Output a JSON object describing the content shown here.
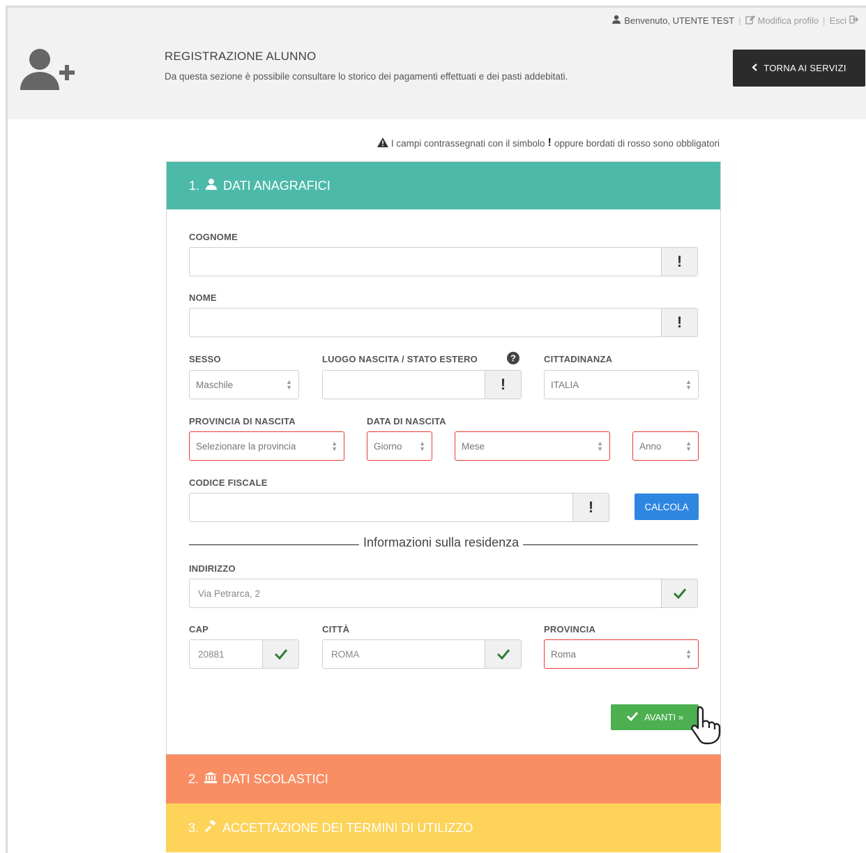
{
  "topbar": {
    "welcome": "Benvenuto, UTENTE TEST",
    "edit_profile": "Modifica profilo",
    "logout": "Esci",
    "separator": "|"
  },
  "header": {
    "title": "REGISTRAZIONE ALUNNO",
    "description": "Da questa sezione è possibile consultare lo storico dei pagamenti effettuati e dei pasti addebitati.",
    "back_button": "TORNA AI SERVIZI"
  },
  "required_note": {
    "before": "I campi contrassegnati con il simbolo",
    "after": "oppure bordati di rosso sono obbligatori"
  },
  "step1": {
    "number": "1.",
    "title": "DATI ANAGRAFICI",
    "color": "#4dbaa9"
  },
  "form": {
    "cognome": {
      "label": "COGNOME",
      "value": ""
    },
    "nome": {
      "label": "NOME",
      "value": ""
    },
    "sesso": {
      "label": "SESSO",
      "value": "Maschile"
    },
    "luogo_nascita": {
      "label": "LUOGO NASCITA / STATO ESTERO",
      "value": ""
    },
    "cittadinanza": {
      "label": "CITTADINANZA",
      "value": "ITALIA"
    },
    "provincia_nascita": {
      "label": "PROVINCIA DI NASCITA",
      "value": "Selezionare la provincia"
    },
    "data_nascita": {
      "label": "DATA DI NASCITA",
      "giorno": "Giorno",
      "mese": "Mese",
      "anno": "Anno"
    },
    "codice_fiscale": {
      "label": "CODICE FISCALE",
      "value": ""
    },
    "calcola_button": "CALCOLA",
    "residenza_divider": "Informazioni sulla residenza",
    "indirizzo": {
      "label": "INDIRIZZO",
      "value": "Via Petrarca, 2"
    },
    "cap": {
      "label": "CAP",
      "value": "20881"
    },
    "citta": {
      "label": "CITTÀ",
      "value": "ROMA"
    },
    "provincia": {
      "label": "PROVINCIA",
      "value": "Roma"
    },
    "required_mark": "!",
    "next_button": "AVANTI »"
  },
  "step2": {
    "number": "2.",
    "title": "DATI SCOLASTICI",
    "color": "#f98e64"
  },
  "step3": {
    "number": "3.",
    "title": "ACCETTAZIONE DEI TERMINI DI UTILIZZO",
    "color": "#fdd35a"
  },
  "colors": {
    "required_border": "#e53935",
    "valid": "#2e7d32",
    "primary": "#2f86e0",
    "success": "#4caf50"
  }
}
